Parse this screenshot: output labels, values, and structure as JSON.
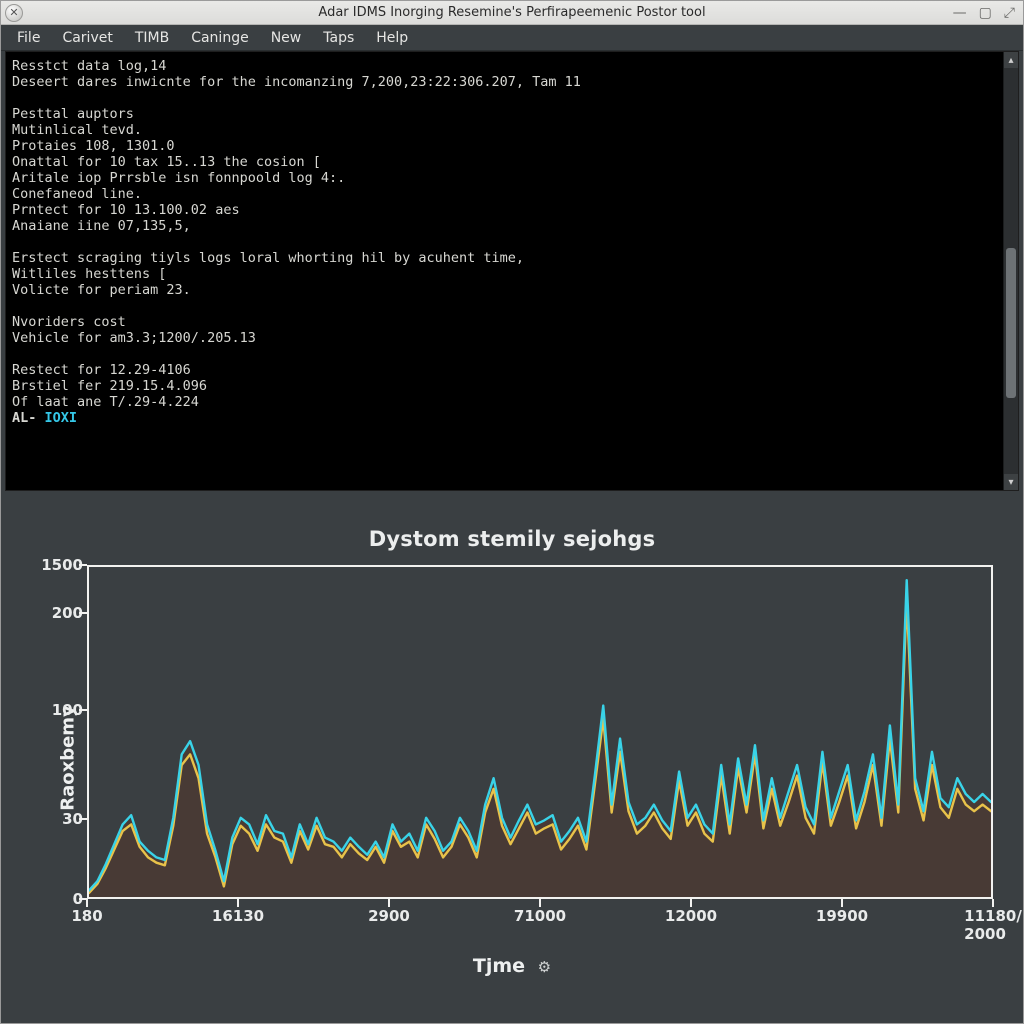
{
  "window": {
    "title": "Adar IDMS Inorging Resemine's Perfirapeemenic Postor tool"
  },
  "menu": {
    "items": [
      "File",
      "Carivet",
      "TIMB",
      "Caninge",
      "New",
      "Taps",
      "Help"
    ]
  },
  "terminal": {
    "lines": [
      "Resstct data log,14",
      "Deseert dares inwicnte for the incomanzing 7,200,23:22:306.207, Tam 11",
      "",
      "Pesttal auptors",
      "Mutinlical tevd.",
      "Protaies 108, 1301.0",
      "Onattal for 10 tax 15..13 the cosion [",
      "Aritale iop Prrsble isn fonnpoold log 4:.",
      "Conefaneod line.",
      "Prntect for 10 13.100.02 aes",
      "Anaiane iine 07,135,5,",
      "",
      "Erstect scraging tiyls logs loral whorting hil by acuhent time,",
      "Witliles hesttens [",
      "Volicte for periam 23.",
      "",
      "Nvoriders cost",
      "Vehicle for am3.3;1200/.205.13",
      "",
      "Restect for 12.29-4106",
      "Brstiel fer 219.15.4.096",
      "Of laat ane T/.29-4.224"
    ],
    "prompt_symbol": "AL-",
    "prompt_text": "IOXI"
  },
  "chart_data": {
    "type": "line",
    "title": "Dystom stemily sejohgs",
    "xlabel": "Tjme",
    "ylabel": "Raoxbemy",
    "xlim": [
      180,
      2000
    ],
    "ylim": [
      0,
      250
    ],
    "y_ticks": [
      0,
      30,
      100,
      200,
      1500
    ],
    "x_ticks": [
      180,
      16130,
      2900,
      71000,
      12000,
      19900,
      "11180/ 2000"
    ],
    "series": [
      {
        "name": "cyan",
        "color": "#39d3e8",
        "values": [
          5,
          12,
          25,
          40,
          55,
          62,
          42,
          35,
          30,
          28,
          60,
          108,
          118,
          100,
          55,
          35,
          12,
          45,
          60,
          55,
          40,
          62,
          50,
          48,
          30,
          55,
          40,
          60,
          45,
          42,
          35,
          45,
          38,
          32,
          42,
          30,
          55,
          42,
          48,
          35,
          60,
          50,
          35,
          42,
          60,
          50,
          35,
          70,
          90,
          60,
          45,
          58,
          70,
          55,
          58,
          62,
          42,
          50,
          60,
          42,
          92,
          145,
          70,
          120,
          72,
          55,
          60,
          70,
          58,
          50,
          95,
          60,
          70,
          55,
          48,
          100,
          55,
          105,
          70,
          115,
          58,
          90,
          60,
          80,
          100,
          68,
          55,
          110,
          60,
          80,
          100,
          58,
          80,
          108,
          60,
          130,
          70,
          240,
          90,
          65,
          110,
          75,
          68,
          90,
          78,
          72,
          78,
          72
        ]
      },
      {
        "name": "yellow",
        "color": "#e8c24a",
        "values": [
          3,
          10,
          22,
          36,
          50,
          55,
          38,
          30,
          26,
          24,
          54,
          100,
          108,
          90,
          48,
          30,
          8,
          40,
          54,
          48,
          35,
          55,
          45,
          42,
          26,
          50,
          36,
          54,
          40,
          38,
          30,
          40,
          33,
          28,
          38,
          26,
          50,
          38,
          42,
          30,
          55,
          44,
          30,
          38,
          55,
          45,
          30,
          64,
          82,
          54,
          40,
          52,
          64,
          48,
          52,
          55,
          36,
          44,
          54,
          36,
          85,
          135,
          64,
          110,
          65,
          48,
          54,
          64,
          52,
          44,
          88,
          54,
          64,
          48,
          42,
          92,
          48,
          98,
          64,
          108,
          52,
          82,
          54,
          72,
          92,
          60,
          48,
          102,
          54,
          72,
          92,
          52,
          72,
          100,
          54,
          120,
          64,
          225,
          82,
          58,
          100,
          68,
          60,
          82,
          70,
          65,
          70,
          65
        ]
      }
    ]
  },
  "colors": {
    "terminal_fg": "#d7d7d2",
    "accent": "#35c8e8",
    "chart_bg": "#3a3f42",
    "area_fill": "#4b3a32"
  }
}
